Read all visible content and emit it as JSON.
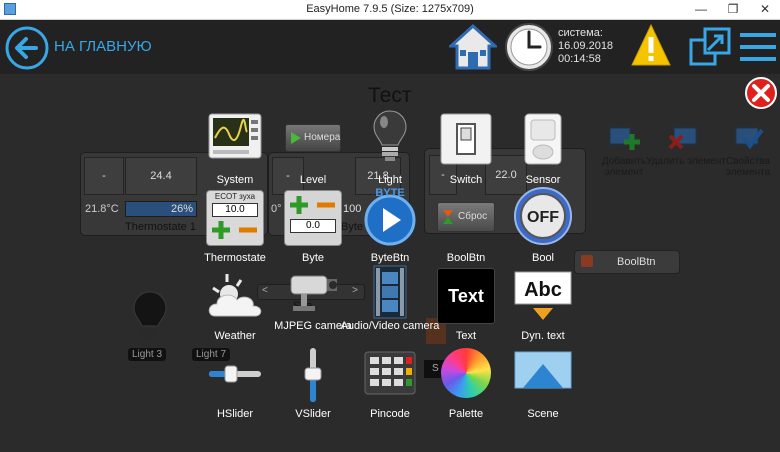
{
  "window": {
    "title": "EasyHome 7.9.5 (Size: 1275x709)",
    "minimize_glyph": "—",
    "restore_glyph": "❐",
    "close_glyph": "✕"
  },
  "topbar": {
    "home_link": "НА ГЛАВНУЮ",
    "system_label": "система:",
    "date": "16.09.2018",
    "time": "00:14:58"
  },
  "page": {
    "title": "Тест"
  },
  "background": {
    "thermostat": {
      "minus": "-",
      "value": "24.4",
      "temp": "21.8°C",
      "percent": "26%",
      "name": "Thermostate 1"
    },
    "panel2": {
      "minus": "-",
      "value": "21.8",
      "temp": "0°",
      "percent": "100",
      "name": "Byte"
    },
    "panel3": {
      "minus": "-",
      "value": "22.0"
    },
    "boolbtn_label": "BoolBtn",
    "light_labels": [
      "Light 3",
      "Light 7"
    ],
    "scene_label": "Sce"
  },
  "right_tools": [
    {
      "label": "Добавить элемент",
      "icon": "add-element-icon"
    },
    {
      "label": "Удалить элемент",
      "icon": "delete-element-icon"
    },
    {
      "label": "Свойства элемента",
      "icon": "element-properties-icon"
    }
  ],
  "palette": [
    {
      "label": "System",
      "icon": "system-monitor-icon"
    },
    {
      "label": "Level",
      "icon": "level-icon",
      "icon_text": "Номера"
    },
    {
      "label": "Light",
      "icon": "lightbulb-icon"
    },
    {
      "label": "Switch",
      "icon": "switch-icon"
    },
    {
      "label": "Sensor",
      "icon": "sensor-icon"
    },
    {
      "label": "Thermostate",
      "icon": "thermostat-icon",
      "icon_text": "ECOT зуха",
      "icon_value": "10.0"
    },
    {
      "label": "Byte",
      "icon": "byte-icon",
      "icon_value": "0.0"
    },
    {
      "label": "ByteBtn",
      "icon": "bytebtn-icon",
      "icon_text": "BYTE"
    },
    {
      "label": "BoolBtn",
      "icon": "boolbtn-icon",
      "icon_text": "Сброс"
    },
    {
      "label": "Bool",
      "icon": "bool-icon",
      "icon_text": "OFF"
    },
    {
      "label": "Weather",
      "icon": "weather-icon"
    },
    {
      "label": "MJPEG camera",
      "icon": "mjpeg-camera-icon"
    },
    {
      "label": "Audio/Video camera",
      "icon": "av-camera-icon"
    },
    {
      "label": "Text",
      "icon": "text-icon",
      "icon_text": "Text"
    },
    {
      "label": "Dyn. text",
      "icon": "dyn-text-icon",
      "icon_text": "Abc"
    },
    {
      "label": "HSlider",
      "icon": "hslider-icon"
    },
    {
      "label": "VSlider",
      "icon": "vslider-icon"
    },
    {
      "label": "Pincode",
      "icon": "pincode-icon"
    },
    {
      "label": "Palette",
      "icon": "palette-icon"
    },
    {
      "label": "Scene",
      "icon": "scene-icon"
    }
  ],
  "colors": {
    "accent": "#39a6e6",
    "warning": "#f5c400",
    "close": "#e0201c"
  }
}
